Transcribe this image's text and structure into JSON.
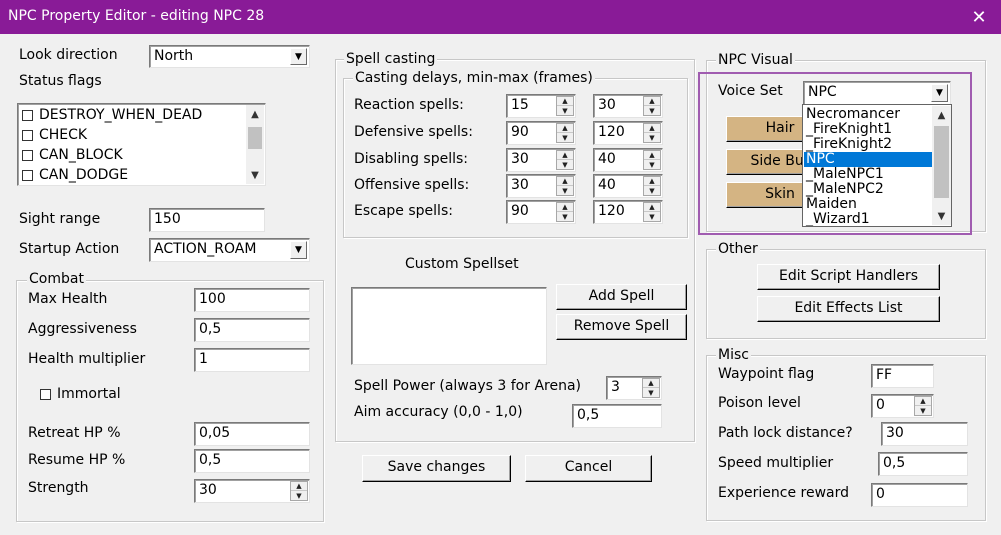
{
  "window": {
    "title": "NPC Property Editor - editing NPC 28",
    "close_glyph": "✕"
  },
  "left": {
    "look_direction_label": "Look direction",
    "look_direction_value": "North",
    "status_flags_label": "Status flags",
    "flags": [
      {
        "label": "DESTROY_WHEN_DEAD",
        "checked": false
      },
      {
        "label": "CHECK",
        "checked": false
      },
      {
        "label": "CAN_BLOCK",
        "checked": false
      },
      {
        "label": "CAN_DODGE",
        "checked": false
      }
    ],
    "sight_range_label": "Sight range",
    "sight_range_value": "150",
    "startup_action_label": "Startup Action",
    "startup_action_value": "ACTION_ROAM"
  },
  "combat": {
    "title": "Combat",
    "max_health_label": "Max Health",
    "max_health_value": "100",
    "aggressiveness_label": "Aggressiveness",
    "aggressiveness_value": "0,5",
    "health_multiplier_label": "Health multiplier",
    "health_multiplier_value": "1",
    "immortal_label": "Immortal",
    "immortal_checked": false,
    "retreat_hp_label": "Retreat HP %",
    "retreat_hp_value": "0,05",
    "resume_hp_label": "Resume HP %",
    "resume_hp_value": "0,5",
    "strength_label": "Strength",
    "strength_value": "30"
  },
  "spell": {
    "title": "Spell casting",
    "delays_title": "Casting delays, min-max (frames)",
    "rows": [
      {
        "label": "Reaction spells:",
        "min": "15",
        "max": "30"
      },
      {
        "label": "Defensive spells:",
        "min": "90",
        "max": "120"
      },
      {
        "label": "Disabling spells:",
        "min": "30",
        "max": "40"
      },
      {
        "label": "Offensive spells:",
        "min": "30",
        "max": "40"
      },
      {
        "label": "Escape spells:",
        "min": "90",
        "max": "120"
      }
    ],
    "custom_spellset_label": "Custom Spellset",
    "add_spell": "Add Spell",
    "remove_spell": "Remove Spell",
    "spell_power_label": "Spell Power (always 3 for Arena)",
    "spell_power_value": "3",
    "aim_accuracy_label": "Aim accuracy (0,0 - 1,0)",
    "aim_accuracy_value": "0,5"
  },
  "actions": {
    "save": "Save changes",
    "cancel": "Cancel"
  },
  "visual": {
    "title": "NPC Visual",
    "voice_set_label": "Voice Set",
    "voice_set_value": "NPC",
    "buttons": [
      "Hair",
      "Side Bur",
      "Skin"
    ],
    "dropdown_items": [
      "Necromancer",
      "_FireKnight1",
      "_FireKnight2",
      "NPC",
      "_MaleNPC1",
      "_MaleNPC2",
      "Maiden",
      "_Wizard1"
    ],
    "dropdown_selected": "NPC",
    "highlight_color": "#a05cb0",
    "selection_color": "#0078d7"
  },
  "other": {
    "title": "Other",
    "edit_script_handlers": "Edit Script Handlers",
    "edit_effects_list": "Edit Effects List"
  },
  "misc": {
    "title": "Misc",
    "waypoint_flag_label": "Waypoint flag",
    "waypoint_flag_value": "FF",
    "poison_level_label": "Poison level",
    "poison_level_value": "0",
    "path_lock_label": "Path lock distance?",
    "path_lock_value": "30",
    "speed_multiplier_label": "Speed multiplier",
    "speed_multiplier_value": "0,5",
    "experience_reward_label": "Experience reward",
    "experience_reward_value": "0"
  },
  "colors": {
    "titlebar": "#891b97",
    "tan_button": "#d4b483",
    "window_bg": "#f0f0f0"
  }
}
